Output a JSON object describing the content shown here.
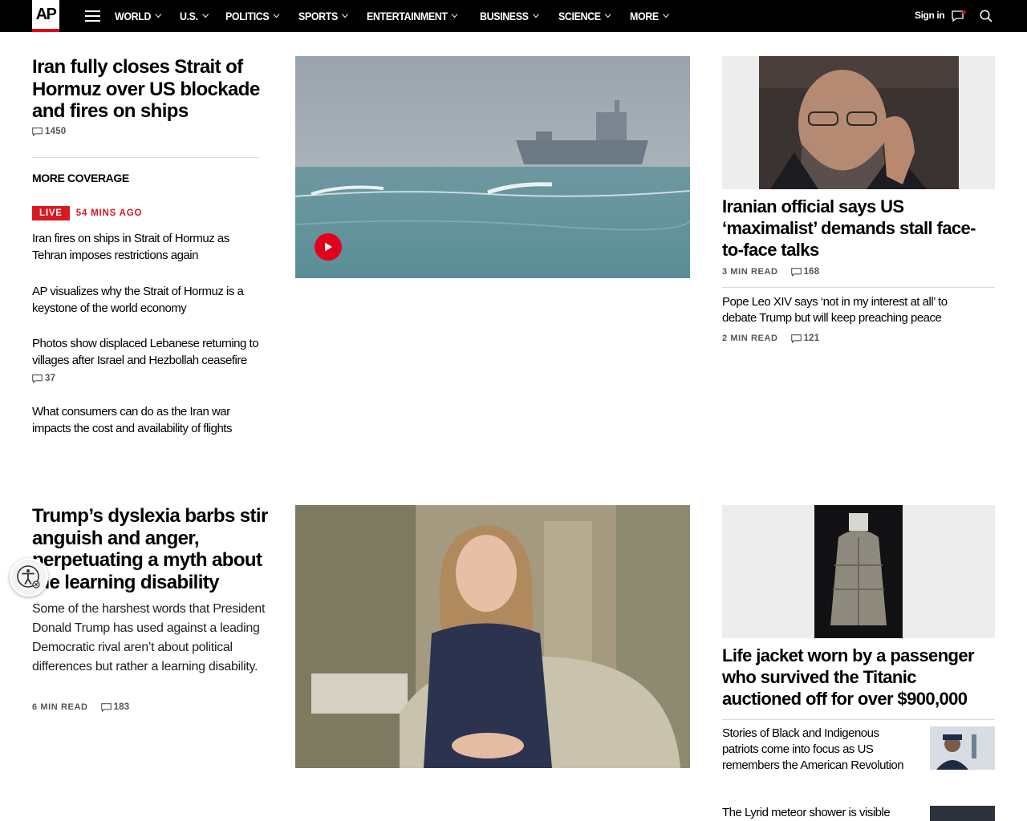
{
  "nav": {
    "logo": "AP",
    "items": [
      "WORLD",
      "U.S.",
      "POLITICS",
      "SPORTS",
      "ENTERTAINMENT",
      "BUSINESS",
      "SCIENCE",
      "MORE"
    ],
    "signin": "Sign in"
  },
  "top_story": {
    "headline": "Iran fully closes Strait of Hormuz over US blockade and fires on ships",
    "comments": "1450",
    "more_coverage_label": "MORE COVERAGE",
    "live_label": "LIVE",
    "live_time": "54 MINS AGO",
    "links": [
      {
        "text": "Iran fires on ships in Strait of Hormuz as Tehran imposes restrictions again"
      },
      {
        "text": "AP visualizes why the Strait of Hormuz is a keystone of the world economy"
      },
      {
        "text": "Photos show displaced Lebanese returning to villages after Israel and Hezbollah ceasefire",
        "comments": "37"
      },
      {
        "text": "What consumers can do as the Iran war impacts the cost and availability of flights"
      }
    ]
  },
  "right_top": {
    "headline": "Iranian official says US ‘maximalist’ demands stall face-to-face talks",
    "read_time": "3 MIN READ",
    "comments": "168",
    "second_headline": "Pope Leo XIV says ‘not in my interest at all’ to debate Trump but will keep preaching peace",
    "second_read_time": "2 MIN READ",
    "second_comments": "121"
  },
  "second_story": {
    "headline": "Trump’s dyslexia barbs stir anguish and anger, perpetuating a myth about the learning disability",
    "summary": "Some of the harshest words that President Donald Trump has used against a leading Democratic rival aren’t about political differences but rather a learning disability.",
    "read_time": "6 MIN READ",
    "comments": "183"
  },
  "right_bottom": {
    "headline": "Life jacket worn by a passenger who survived the Titanic auctioned off for over $900,000",
    "second_headline": "Stories of Black and Indigenous patriots come into focus as US remembers the American Revolution",
    "third_headline": "The Lyrid meteor shower is visible"
  },
  "colors": {
    "nav_bg": "#000000",
    "accent_red": "#d71920",
    "play_red": "#e2001a"
  }
}
